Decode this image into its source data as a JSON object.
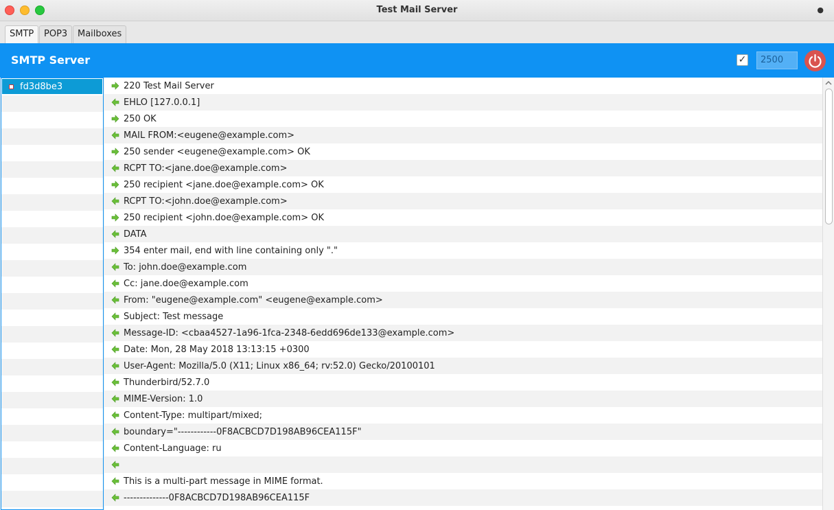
{
  "window": {
    "title": "Test Mail Server",
    "menu_dot": "●"
  },
  "tabs": [
    {
      "label": "SMTP",
      "active": true
    },
    {
      "label": "POP3",
      "active": false
    },
    {
      "label": "Mailboxes",
      "active": false
    }
  ],
  "header": {
    "title": "SMTP Server",
    "enabled_checked": true,
    "port": "2500",
    "power_icon": "power-icon",
    "color": "#0f92f3"
  },
  "sessions": [
    {
      "id": "fd3d8be3",
      "selected": true
    }
  ],
  "log": [
    {
      "direction": "out",
      "text": "220 Test Mail Server"
    },
    {
      "direction": "in",
      "text": "EHLO [127.0.0.1]"
    },
    {
      "direction": "out",
      "text": "250 OK"
    },
    {
      "direction": "in",
      "text": "MAIL FROM:<eugene@example.com>"
    },
    {
      "direction": "out",
      "text": "250 sender <eugene@example.com> OK"
    },
    {
      "direction": "in",
      "text": "RCPT TO:<jane.doe@example.com>"
    },
    {
      "direction": "out",
      "text": "250 recipient <jane.doe@example.com> OK"
    },
    {
      "direction": "in",
      "text": "RCPT TO:<john.doe@example.com>"
    },
    {
      "direction": "out",
      "text": "250 recipient <john.doe@example.com> OK"
    },
    {
      "direction": "in",
      "text": "DATA"
    },
    {
      "direction": "out",
      "text": "354 enter mail, end with line containing only \".\""
    },
    {
      "direction": "in",
      "text": "To: john.doe@example.com"
    },
    {
      "direction": "in",
      "text": "Cc: jane.doe@example.com"
    },
    {
      "direction": "in",
      "text": "From: \"eugene@example.com\" <eugene@example.com>"
    },
    {
      "direction": "in",
      "text": "Subject: Test message"
    },
    {
      "direction": "in",
      "text": "Message-ID: <cbaa4527-1a96-1fca-2348-6edd696de133@example.com>"
    },
    {
      "direction": "in",
      "text": "Date: Mon, 28 May 2018 13:13:15 +0300"
    },
    {
      "direction": "in",
      "text": "User-Agent: Mozilla/5.0 (X11; Linux x86_64; rv:52.0) Gecko/20100101"
    },
    {
      "direction": "in",
      "text": "Thunderbird/52.7.0"
    },
    {
      "direction": "in",
      "text": "MIME-Version: 1.0"
    },
    {
      "direction": "in",
      "text": "Content-Type: multipart/mixed;"
    },
    {
      "direction": "in",
      "text": "boundary=\"------------0F8ACBCD7D198AB96CEA115F\""
    },
    {
      "direction": "in",
      "text": "Content-Language: ru"
    },
    {
      "direction": "in",
      "text": ""
    },
    {
      "direction": "in",
      "text": "This is a multi-part message in MIME format."
    },
    {
      "direction": "in",
      "text": "--------------0F8ACBCD7D198AB96CEA115F"
    }
  ],
  "icons": {
    "incoming": "arrow-left-icon",
    "outgoing": "arrow-right-icon",
    "arrow_color": "#6bbf3a"
  }
}
